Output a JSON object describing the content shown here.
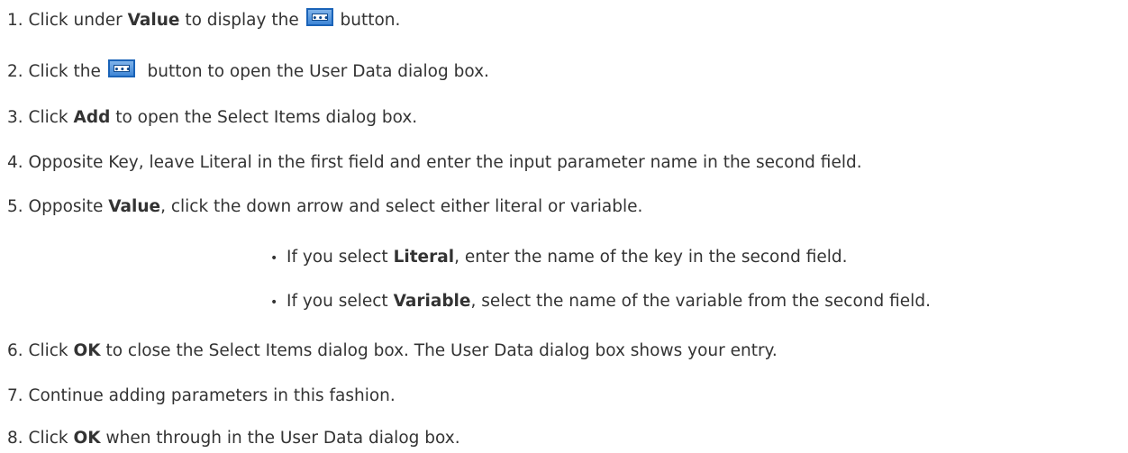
{
  "steps": [
    {
      "num": "1.",
      "t1": "Click under ",
      "b1": "Value",
      "t2": " to display the ",
      "t3": " button."
    },
    {
      "num": "2.",
      "t1": "Click the ",
      "t2": " button to open the User Data dialog box."
    },
    {
      "num": "3.",
      "t1": "Click ",
      "b1": "Add",
      "t2": " to open the Select Items dialog box."
    },
    {
      "num": "4.",
      "t1": "Opposite Key, leave Literal in the first field and enter the input parameter name in the second field."
    },
    {
      "num": "5.",
      "t1": "Opposite ",
      "b1": "Value",
      "t2": ", click the down arrow and select either literal or variable."
    },
    {
      "num": "6.",
      "t1": "Click ",
      "b1": "OK",
      "t2": " to close the Select Items dialog box. The User Data dialog box shows your entry."
    },
    {
      "num": "7.",
      "t1": "Continue adding parameters in this fashion."
    },
    {
      "num": "8.",
      "t1": "Click ",
      "b1": "OK",
      "t2": " when through in the User Data dialog box."
    }
  ],
  "bullets": [
    {
      "dot": "•",
      "t1": "If you select ",
      "b1": "Literal",
      "t2": ", enter the name of the key in the second field."
    },
    {
      "dot": "•",
      "t1": "If you select ",
      "b1": "Variable",
      "t2": ", select the name of the variable from the second field."
    }
  ],
  "icons": {
    "ellipsis_button": "ellipsis-button-icon",
    "accent_color": "#1a63b8"
  }
}
